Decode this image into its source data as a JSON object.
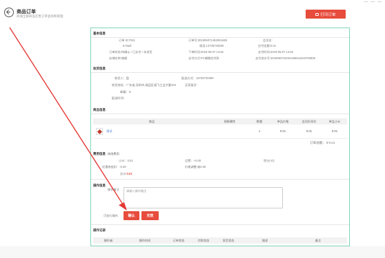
{
  "header": {
    "title": "商品订单",
    "subtitle": "商城全部商品在售订单查询和管理",
    "print_label": "打印订单",
    "top_dash": "— — —"
  },
  "basic_info": {
    "title": "基本信息",
    "order_id": "订单 ID:7811",
    "order_no": "订单号:20190507145205184B",
    "phone_label": "会员名:",
    "email_label": "E-Mail:",
    "phone": "电话:13728740390",
    "pay_amount": "应付金额:0.01",
    "status": "订单状态:待确认 / 已支付 / 未发货",
    "order_time": "下单时间:2019-05-07 14:52",
    "pay_time": "支付时间:2019-05-07 14:52",
    "shop_name": "店铺名称:旗舰",
    "pay_method": "支付方式:PC端微信付款",
    "pay_serial": "支付流水号:2019050722001455511033700805"
  },
  "receive_info": {
    "title": "收货信息",
    "receiver": "收货人：盘",
    "delivery": "配送方式：13728740390",
    "address": "收货地址：广东省,深圳市,福田区福飞工业大厦402",
    "zip": "邮编：N",
    "delivery_time": "配送时间：",
    "phone2": "买家留言："
  },
  "goods": {
    "title": "商品信息",
    "headers": [
      "商品",
      "规格属性",
      "数量",
      "单品价格",
      "会员折扣价",
      "单品小计"
    ],
    "rows": [
      {
        "name": "测试",
        "spec": "",
        "qty": "1",
        "price": "0.01",
        "discount": "0.01",
        "subtotal": "0.01"
      }
    ],
    "total": "订单总额：￥0.01"
  },
  "fee_info": {
    "title": "费用信息",
    "edit_label": "修改费用",
    "subtotal": "小计：0.01",
    "shipping": "运费：+0.00",
    "points": "积分(-0)：",
    "coupon": "优惠券抵扣：-0.00",
    "adjust": "价格调整:减0.00",
    "total_label": "总计:",
    "total_value": "0.01"
  },
  "action_info": {
    "title": "操作信息",
    "remark_label": "操作备注",
    "placeholder": "请输入操作备注",
    "can_do_label": "可执行操作",
    "confirm_label": "确认",
    "invalid_label": "无效"
  },
  "log": {
    "title": "操作记录",
    "headers": [
      "操作者",
      "操作时间",
      "订单状态",
      "付款状态",
      "发货状态",
      "描述",
      "备注"
    ]
  },
  "colors": {
    "accent": "#e74c3c",
    "panel_border": "#7fd4b5",
    "link": "#3b7bd6"
  }
}
